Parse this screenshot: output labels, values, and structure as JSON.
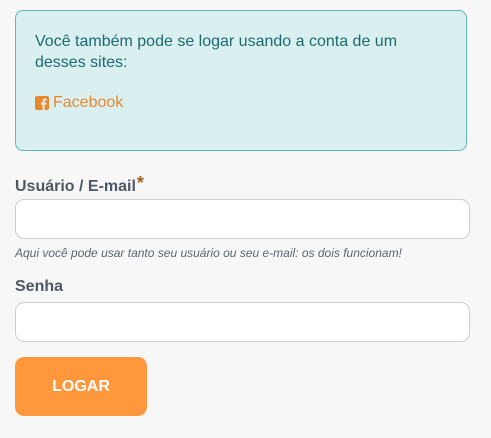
{
  "social_login": {
    "intro_text": "Você também pode se logar usando a conta de um desses sites:",
    "facebook": {
      "label": "Facebook",
      "icon": "facebook-square-icon",
      "color": "#e9882e"
    },
    "box_background": "#d9eff0",
    "box_border": "#5fb7b6"
  },
  "form": {
    "username": {
      "label": "Usuário / E-mail",
      "required_marker": "*",
      "value": "",
      "help_text": "Aqui você pode usar tanto seu usuário ou seu e-mail: os dois funcionam!"
    },
    "password": {
      "label": "Senha",
      "value": ""
    },
    "submit": {
      "label": "LOGAR",
      "color": "#ff983d"
    }
  }
}
